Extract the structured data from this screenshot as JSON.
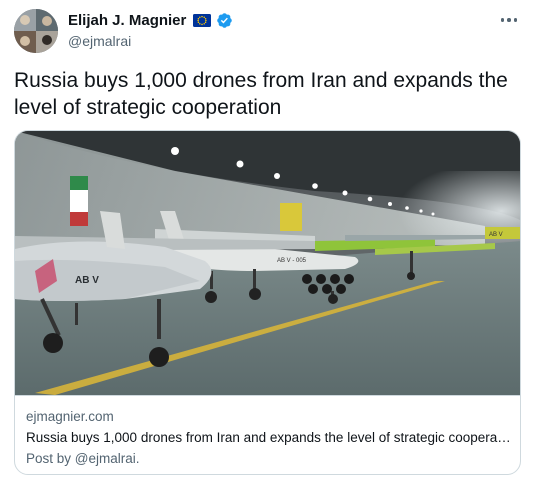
{
  "author": {
    "display_name": "Elijah J. Magnier",
    "handle": "@ejmalrai",
    "flag_icon": "eu-flag-icon",
    "verified_icon": "verified-badge-icon"
  },
  "tweet": {
    "text": "Russia buys 1,000 drones from Iran and expands the level of strategic cooperation"
  },
  "card": {
    "image_alt": "Drones lined up in an underground tunnel hangar",
    "image_labels": [
      "AB V",
      "AB V - 005",
      "AB V"
    ],
    "domain": "ejmagnier.com",
    "title": "Russia buys 1,000 drones from Iran and expands the level of strategic coopera…",
    "posted_by": "Post by @ejmalrai."
  },
  "colors": {
    "text_primary": "#0f1419",
    "text_secondary": "#536471",
    "border": "#cfd9de",
    "verified_blue": "#1d9bf0",
    "eu_blue": "#003399",
    "eu_stars": "#ffcc00"
  }
}
